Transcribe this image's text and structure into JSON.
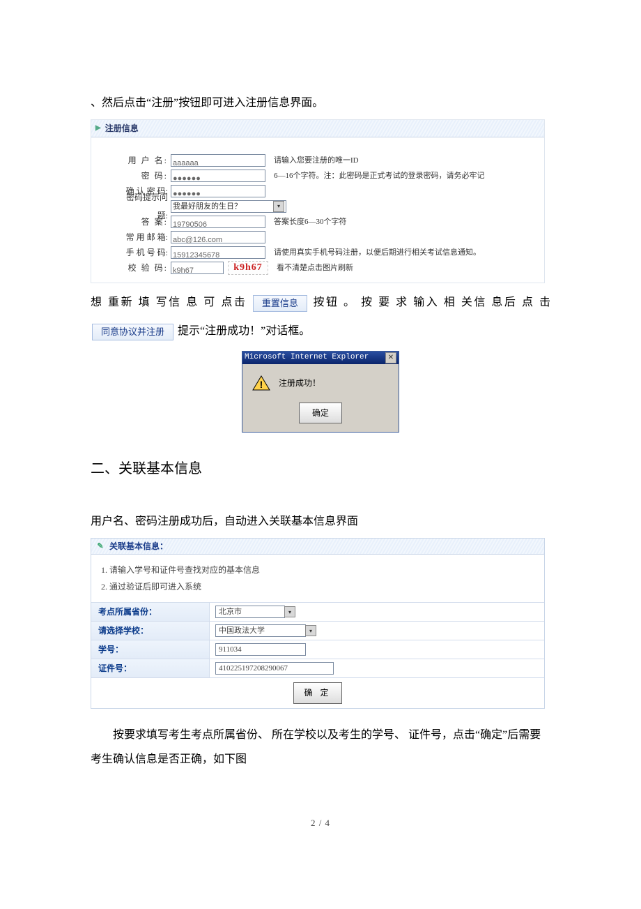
{
  "text": {
    "para1": "、然后点击“注册”按钮即可进入注册信息界面。",
    "para2a": "想 重新 填 写信 息 可 点击",
    "para2b": "按钮 。 按 要 求 输入 相 关信 息后 点 击",
    "para3": "提示“注册成功！”对话框。",
    "h2": "二、关联基本信息",
    "para4": "用户名、密码注册成功后，自动进入关联基本信息界面",
    "para5": "按要求填写考生考点所属省份、 所在学校以及考生的学号、 证件号，点击“确定”后需要考生确认信息是否正确，如下图",
    "pagenum": "2 / 4"
  },
  "buttons": {
    "reset": "重置信息",
    "agree": "同意协议并注册"
  },
  "reg": {
    "header": "注册信息",
    "rows": {
      "username": {
        "label": "用 户 名:",
        "value": "aaaaaa",
        "hint": "请输入您要注册的唯一ID"
      },
      "password": {
        "label": "密    码:",
        "value": "●●●●●●",
        "hint": "6—16个字符。注：此密码是正式考试的登录密码，请务必牢记"
      },
      "confirm": {
        "label": "确 认 密 码:",
        "value": "●●●●●●",
        "hint": ""
      },
      "question": {
        "label": "密码提示问题:",
        "value": "我最好朋友的生日？"
      },
      "answer": {
        "label": "答    案:",
        "value": "19790506",
        "hint": "答案长度6—30个字符"
      },
      "email": {
        "label": "常 用 邮 箱:",
        "value": "abc@126.com",
        "hint": ""
      },
      "phone": {
        "label": "手 机 号 码:",
        "value": "15912345678",
        "hint": "请使用真实手机号码注册，以便后期进行相关考试信息通知。"
      },
      "captcha": {
        "label": "校  验  码:",
        "value": "k9h67",
        "img": "k9h67",
        "hint": "看不清楚点击图片刷新"
      }
    }
  },
  "dialog": {
    "title": "Microsoft Internet Explorer",
    "msg": "注册成功！",
    "ok": "确定"
  },
  "link": {
    "header": "关联基本信息：",
    "note1": "1. 请输入学号和证件号查找对应的基本信息",
    "note2": "2. 通过验证后即可进入系统",
    "rows": {
      "province": {
        "k": "考点所属省份：",
        "v": "北京市"
      },
      "school": {
        "k": "请选择学校：",
        "v": "中国政法大学"
      },
      "sid": {
        "k": "学号：",
        "v": "911034"
      },
      "idno": {
        "k": "证件号：",
        "v": "410225197208290067"
      }
    },
    "ok": "确 定"
  }
}
